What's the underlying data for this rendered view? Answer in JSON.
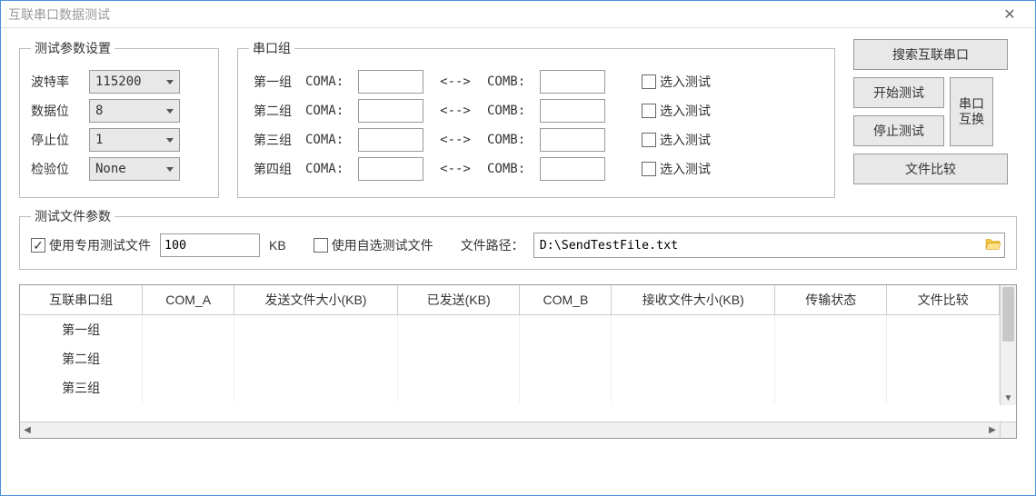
{
  "window": {
    "title": "互联串口数据测试"
  },
  "params": {
    "legend": "测试参数设置",
    "baudrate_label": "波特率",
    "baudrate_value": "115200",
    "databits_label": "数据位",
    "databits_value": "8",
    "stopbits_label": "停止位",
    "stopbits_value": "1",
    "parity_label": "检验位",
    "parity_value": "None"
  },
  "serial": {
    "legend": "串口组",
    "coma_label": "COMA:",
    "comb_label": "COMB:",
    "arrow": "<-->",
    "select_test_label": "选入测试",
    "groups": [
      {
        "label": "第一组",
        "coma": "",
        "comb": ""
      },
      {
        "label": "第二组",
        "coma": "",
        "comb": ""
      },
      {
        "label": "第三组",
        "coma": "",
        "comb": ""
      },
      {
        "label": "第四组",
        "coma": "",
        "comb": ""
      }
    ]
  },
  "buttons": {
    "search": "搜索互联串口",
    "start": "开始测试",
    "stop": "停止测试",
    "swap": "串口互换",
    "compare": "文件比较"
  },
  "file": {
    "legend": "测试文件参数",
    "use_dedicated_label": "使用专用测试文件",
    "size_value": "100",
    "size_unit": "KB",
    "use_custom_label": "使用自选测试文件",
    "path_label": "文件路径：",
    "path_value": "D:\\SendTestFile.txt"
  },
  "table": {
    "headers": [
      "互联串口组",
      "COM_A",
      "发送文件大小(KB)",
      "已发送(KB)",
      "COM_B",
      "接收文件大小(KB)",
      "传输状态",
      "文件比较"
    ],
    "rows": [
      {
        "group": "第一组"
      },
      {
        "group": "第二组"
      },
      {
        "group": "第三组"
      }
    ]
  }
}
